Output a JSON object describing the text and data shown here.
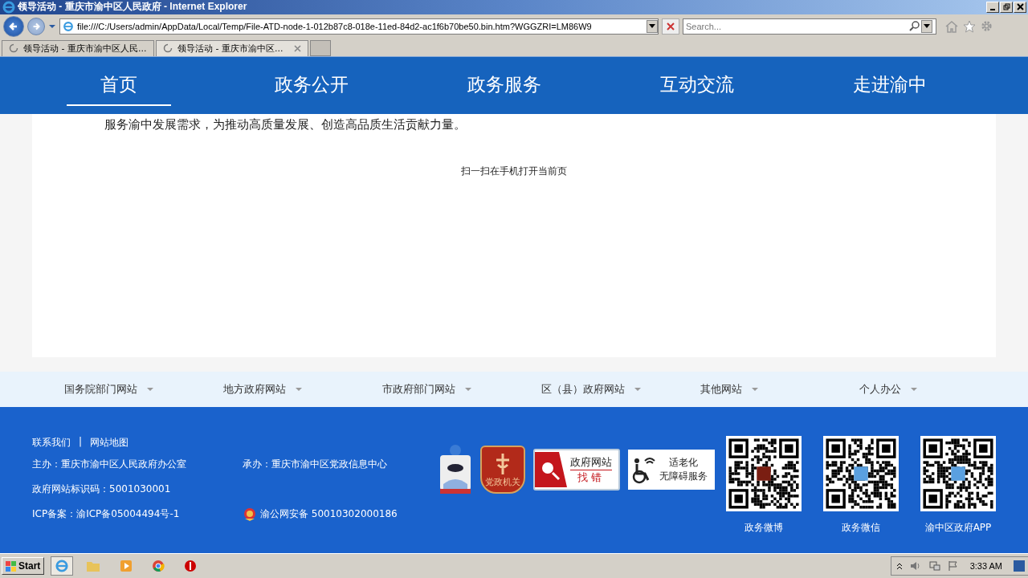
{
  "window": {
    "title": "领导活动 - 重庆市渝中区人民政府 - Internet Explorer"
  },
  "address_bar": {
    "value": "file:///C:/Users/admin/AppData/Local/Temp/File-ATD-node-1-012b87c8-018e-11ed-84d2-ac1f6b70be50.bin.htm?WGGZRI=LM86W9"
  },
  "search": {
    "placeholder": "Search..."
  },
  "tabs": [
    {
      "label": "领导活动 - 重庆市渝中区人民...",
      "selected": false
    },
    {
      "label": "领导活动 - 重庆市渝中区...",
      "selected": true
    }
  ],
  "nav": [
    {
      "label": "首页",
      "selected": true
    },
    {
      "label": "政务公开",
      "selected": false
    },
    {
      "label": "政务服务",
      "selected": false
    },
    {
      "label": "互动交流",
      "selected": false
    },
    {
      "label": "走进渝中",
      "selected": false
    }
  ],
  "content": {
    "paragraph": "服务渝中发展需求，为推动高质量发展、创造高品质生活贡献力量。",
    "qr_caption": "扫一扫在手机打开当前页"
  },
  "site_links": [
    "国务院部门网站",
    "地方政府网站",
    "市政府部门网站",
    "区（县）政府网站",
    "其他网站",
    "个人办公"
  ],
  "footer": {
    "links": [
      "联系我们",
      "网站地图"
    ],
    "separator": "|",
    "sponsor": "主办：重庆市渝中区人民政府办公室",
    "organizer": "承办：重庆市渝中区党政信息中心",
    "site_code": "政府网站标识码：5001030001",
    "icp": "ICP备案：渝ICP备05004494号-1",
    "police": "渝公网安备 50010302000186",
    "badge_party": "党政机关",
    "error_report": [
      "政府网站",
      "找错"
    ],
    "accessibility": [
      "适老化",
      "无障碍服务"
    ],
    "qr_codes": [
      {
        "caption": "政务微博"
      },
      {
        "caption": "政务微信"
      },
      {
        "caption": "渝中区政府APP"
      }
    ]
  },
  "taskbar": {
    "start": "Start",
    "clock": "3:33 AM"
  }
}
